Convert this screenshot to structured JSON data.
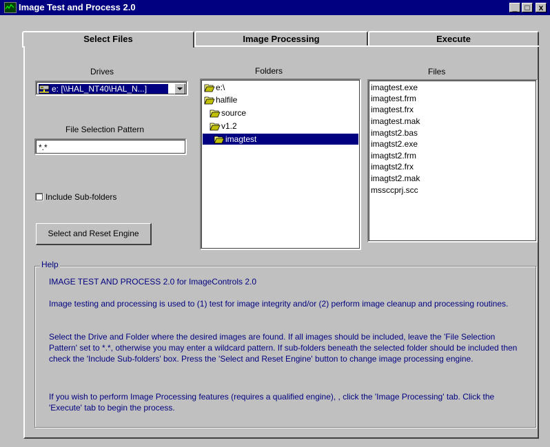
{
  "window": {
    "title": "Image Test and Process 2.0",
    "controls": {
      "minimize": "_",
      "maximize": "□",
      "close": "x"
    }
  },
  "tabs": [
    {
      "label": "Select Files",
      "active": true
    },
    {
      "label": "Image Processing",
      "active": false
    },
    {
      "label": "Execute",
      "active": false
    }
  ],
  "drives": {
    "label": "Drives",
    "selected": "e: [\\\\HAL_NT40\\HAL_N...]",
    "icon": "network-drive-icon"
  },
  "pattern": {
    "label": "File Selection Pattern",
    "value": "*.*"
  },
  "subfolders": {
    "label": "Include Sub-folders",
    "checked": false
  },
  "select_button": "Select and Reset Engine",
  "folders": {
    "label": "Folders",
    "items": [
      {
        "name": "e:\\",
        "indent": 0,
        "open": true,
        "selected": false
      },
      {
        "name": "halfile",
        "indent": 0,
        "open": true,
        "selected": false
      },
      {
        "name": "source",
        "indent": 1,
        "open": true,
        "selected": false
      },
      {
        "name": "v1.2",
        "indent": 1,
        "open": true,
        "selected": false
      },
      {
        "name": "imagtest",
        "indent": 2,
        "open": true,
        "selected": true
      }
    ]
  },
  "files": {
    "label": "Files",
    "items": [
      "imagtest.exe",
      "imagtest.frm",
      "imagtest.frx",
      "imagtest.mak",
      "imagtst2.bas",
      "imagtst2.exe",
      "imagtst2.frm",
      "imagtst2.frx",
      "imagtst2.mak",
      "mssccprj.scc"
    ]
  },
  "help": {
    "legend": "Help",
    "paragraphs": [
      "IMAGE TEST AND PROCESS 2.0 for ImageControls 2.0",
      "Image testing and processing is used to (1) test for image integrity and/or (2) perform image cleanup and processing routines.",
      "Select the Drive and Folder where the desired images are found. If all images should be included, leave the 'File Selection Pattern' set to *.*, otherwise you may enter a wildcard pattern. If sub-folders beneath the selected folder should be included then check the 'Include Sub-folders' box. Press the 'Select and Reset Engine' button to change image processing engine.",
      "If you wish to perform Image Processing features (requires a qualified engine), , click the 'Image Processing' tab.  Click the 'Execute' tab to begin the process."
    ]
  },
  "colors": {
    "titlebar": "#000080",
    "face": "#c0c0c0",
    "selection": "#000080",
    "help_text": "#000080"
  }
}
